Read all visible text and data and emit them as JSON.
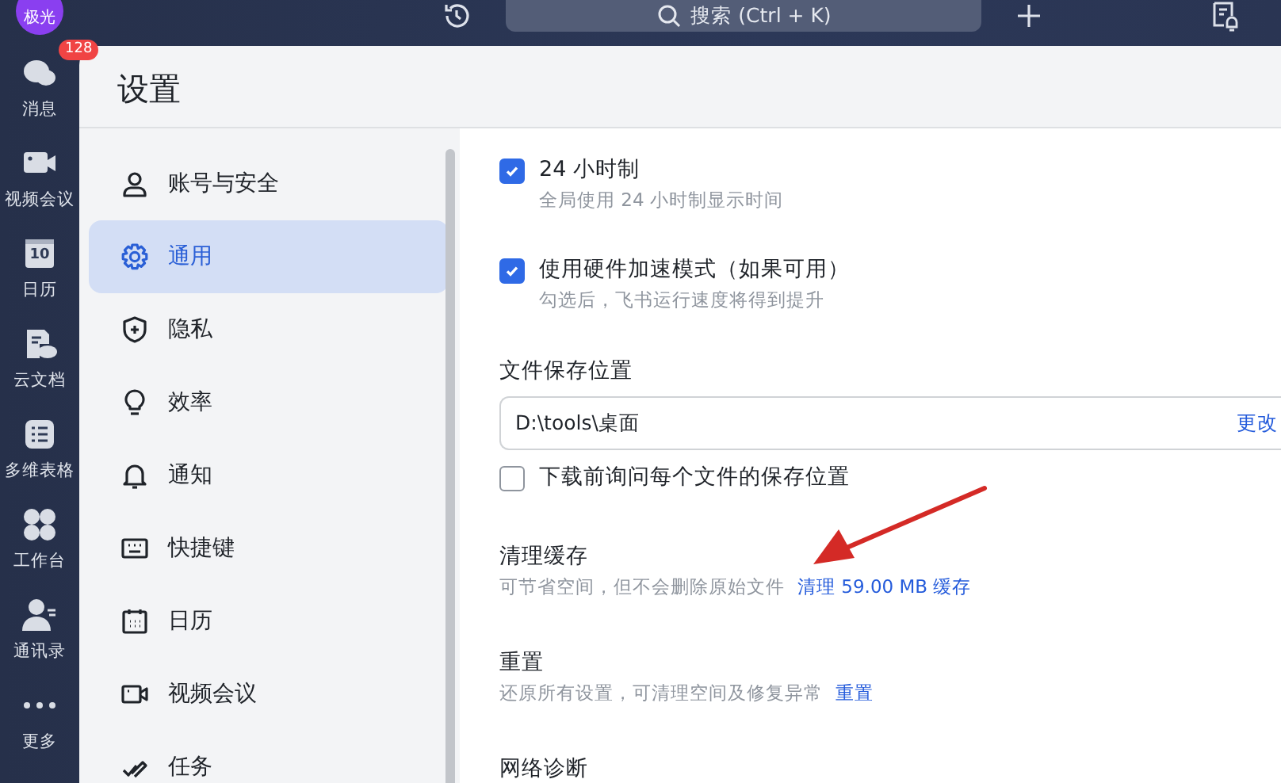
{
  "top_bar": {
    "search": {
      "placeholder": "搜索 (Ctrl + K)"
    }
  },
  "rail": {
    "avatar": "极光",
    "items": [
      {
        "kind": "chat",
        "label": "消息",
        "badge": "128"
      },
      {
        "kind": "video",
        "label": "视频会议"
      },
      {
        "kind": "calendar",
        "label": "日历",
        "icon_text": "10"
      },
      {
        "kind": "docs",
        "label": "云文档"
      },
      {
        "kind": "table",
        "label": "多维表格"
      },
      {
        "kind": "apps",
        "label": "工作台"
      },
      {
        "kind": "contacts",
        "label": "通讯录"
      },
      {
        "kind": "more",
        "label": "更多"
      }
    ]
  },
  "settings": {
    "title": "设置",
    "nav": [
      {
        "kind": "user",
        "label": "账号与安全",
        "selected": false
      },
      {
        "kind": "gear",
        "label": "通用",
        "selected": true
      },
      {
        "kind": "shield",
        "label": "隐私",
        "selected": false
      },
      {
        "kind": "bulb",
        "label": "效率",
        "selected": false
      },
      {
        "kind": "bell",
        "label": "通知",
        "selected": false
      },
      {
        "kind": "keyboard",
        "label": "快捷键",
        "selected": false
      },
      {
        "kind": "calendar",
        "label": "日历",
        "selected": false
      },
      {
        "kind": "video",
        "label": "视频会议",
        "selected": false
      },
      {
        "kind": "task",
        "label": "任务",
        "selected": false
      }
    ],
    "sections": [
      {
        "kind": "checkbox",
        "label": "24 小时制",
        "description": "全局使用 24 小时制显示时间",
        "checked": true
      },
      {
        "kind": "checkbox",
        "label": "使用硬件加速模式（如果可用）",
        "description": "勾选后，飞书运行速度将得到提升",
        "checked": true
      },
      {
        "kind": "path",
        "heading": "文件保存位置",
        "value": "D:\\tools\\桌面",
        "action": "更改"
      },
      {
        "kind": "checkbox",
        "label": "下载前询问每个文件的保存位置",
        "checked": false
      },
      {
        "kind": "action",
        "heading": "清理缓存",
        "description": "可节省空间，但不会删除原始文件",
        "link": "清理 59.00 MB 缓存"
      },
      {
        "kind": "action",
        "heading": "重置",
        "description": "还原所有设置，可清理空间及修复异常",
        "link": "重置"
      },
      {
        "kind": "heading",
        "heading": "网络诊断"
      }
    ]
  }
}
